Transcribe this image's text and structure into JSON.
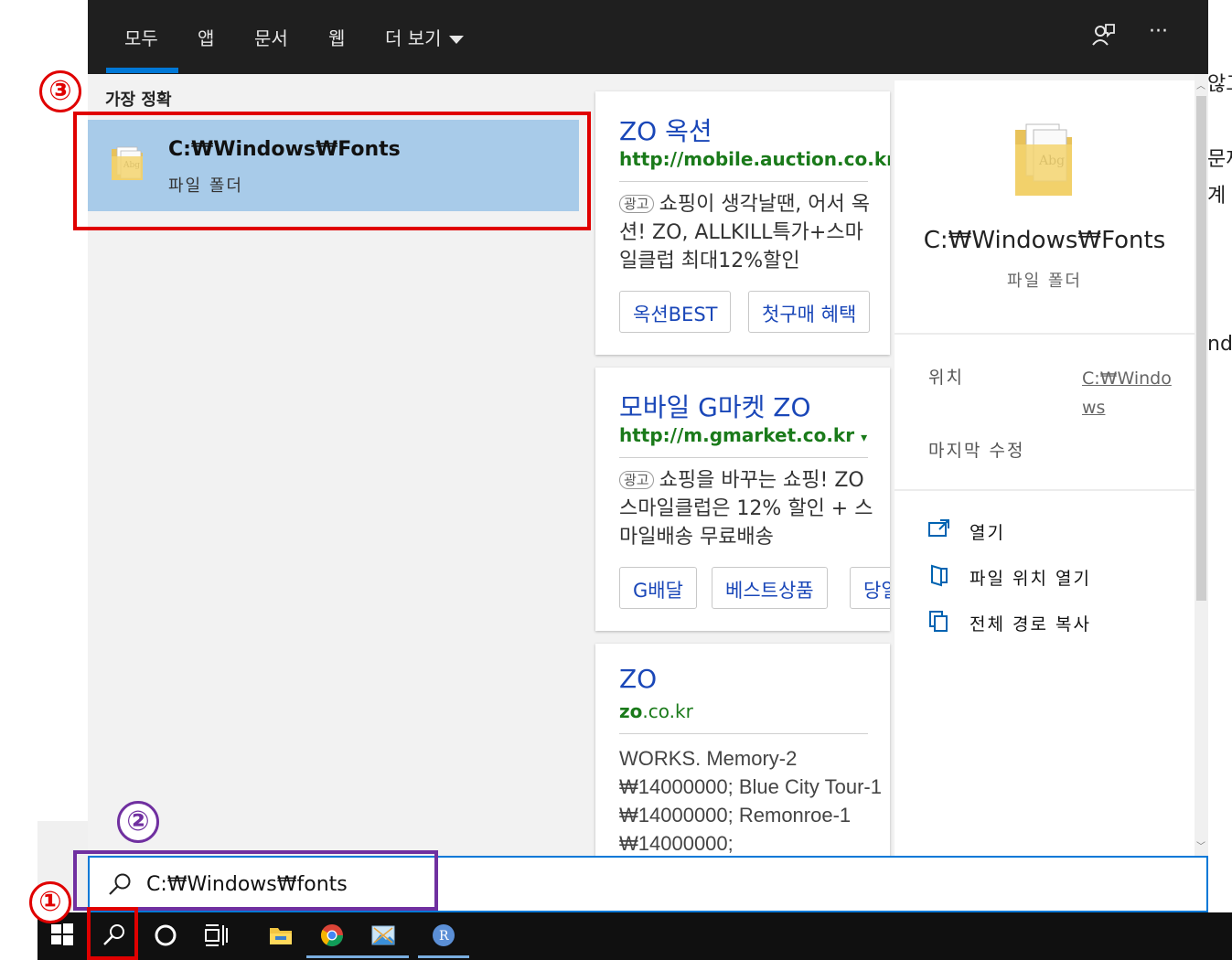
{
  "tabs": [
    {
      "label": "모두",
      "active": true
    },
    {
      "label": "앱"
    },
    {
      "label": "문서"
    },
    {
      "label": "웹"
    },
    {
      "label": "더 보기"
    }
  ],
  "topbar_icons": [
    "feedback-icon",
    "more-icon"
  ],
  "more_label": "···",
  "best_match": {
    "heading": "가장 정확",
    "title": "C:₩Windows₩Fonts",
    "subtitle": "파일 폴더"
  },
  "ads": [
    {
      "title": "ZO 옥션",
      "url": "http://mobile.auction.co.kr",
      "tag": "광고",
      "desc": "쇼핑이 생각날땐, 어서 옥션! ZO, ALLKILL특가+스마일클럽 최대12%할인",
      "chips": [
        "옥션BEST",
        "첫구매 혜택"
      ]
    },
    {
      "title": "모바일 G마켓 ZO",
      "url": "http://m.gmarket.co.kr",
      "url_caret": "▾",
      "tag": "광고",
      "desc": "쇼핑을 바꾸는 쇼핑! ZO 스마일클럽은 12% 할인 + 스마일배송 무료배송",
      "chips": [
        "G배달",
        "베스트상품",
        "당일"
      ]
    },
    {
      "title": "ZO",
      "url_bold": "zo",
      "url_rest": ".co.kr",
      "desc": "WORKS. Memory-2 ₩14000000; Blue City Tour-1 ₩14000000; Remonroe-1 ₩14000000;"
    }
  ],
  "details": {
    "title": "C:₩Windows₩Fonts",
    "subtitle": "파일 폴더",
    "location_label": "위치",
    "location_value": "C:₩Windows",
    "modified_label": "마지막 수정",
    "actions": [
      {
        "label": "열기",
        "icon": "open-icon"
      },
      {
        "label": "파일 위치 열기",
        "icon": "open-file-location-icon"
      },
      {
        "label": "전체 경로 복사",
        "icon": "copy-path-icon"
      }
    ]
  },
  "search": {
    "value": "C:₩Windows₩fonts"
  },
  "taskbar": [
    "windows-start-icon",
    "search-icon",
    "cortana-icon",
    "task-view-icon",
    "file-explorer-icon",
    "chrome-icon",
    "photos-app-icon",
    "r-app-icon"
  ],
  "background_text": [
    "않고",
    "문제",
    "계",
    "nd"
  ],
  "annotations": {
    "one": "①",
    "two": "②",
    "three": "③"
  },
  "colors": {
    "accent": "#0078d7",
    "best_match_bg": "#a8cbe9",
    "annotation_red": "#e00000",
    "annotation_purple": "#7030a0"
  }
}
